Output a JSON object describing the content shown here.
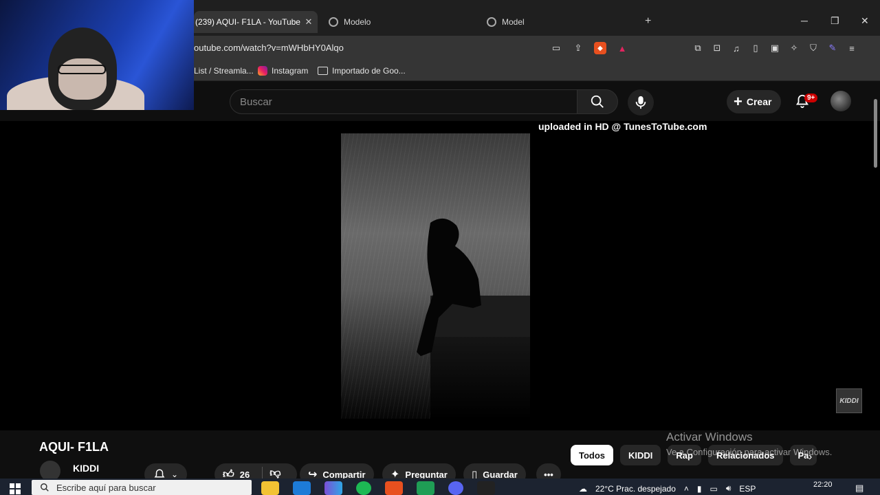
{
  "browser": {
    "tabs": [
      {
        "title": "(239) AQUI- F1LA - YouTube",
        "active": true
      },
      {
        "title": "Modelo",
        "active": false
      },
      {
        "title": "Model",
        "active": false
      }
    ],
    "url": "outube.com/watch?v=mWHbHY0Alqo",
    "bookmarks": {
      "item1": "List / Streamla...",
      "item2": "Instagram",
      "item3": "Importado de Goo..."
    }
  },
  "youtube": {
    "search_placeholder": "Buscar",
    "create_label": "Crear",
    "notification_badge": "9+"
  },
  "player": {
    "overlay_text": "uploaded in HD @ TunesToTube.com",
    "watermark": "KIDDI"
  },
  "video": {
    "title": "AQUI- F1LA",
    "channel": "KIDDI",
    "likes": "26",
    "share_label": "Compartir",
    "ask_label": "Preguntar",
    "save_label": "Guardar"
  },
  "chips": [
    "Todos",
    "KIDDI",
    "Rap",
    "Relacionados",
    "Pa"
  ],
  "windows": {
    "activate_title": "Activar Windows",
    "activate_sub": "Ve a Configuración para activar Windows.",
    "search_placeholder": "Escribe aquí para buscar",
    "weather": "22°C  Prac. despejado",
    "lang": "ESP",
    "time": "22:20"
  },
  "colors": {
    "yt_bg": "#0f0f0f",
    "badge": "#cc0000",
    "chip_active": "#ffffff",
    "taskbar": "#1c2330"
  }
}
